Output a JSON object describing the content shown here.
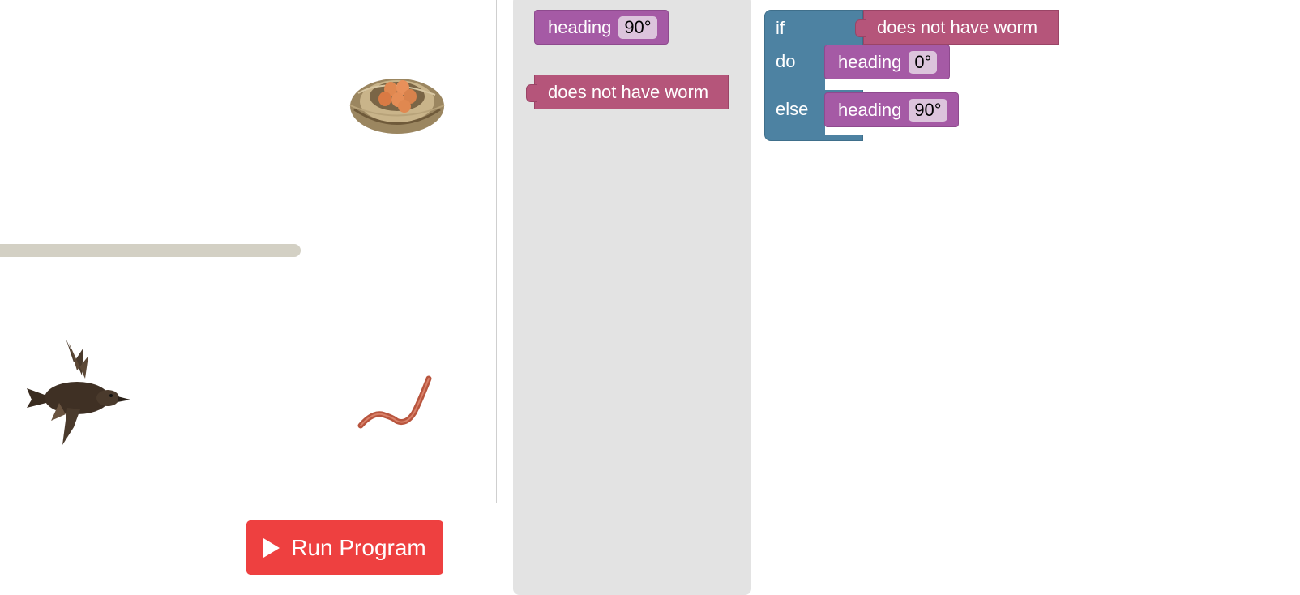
{
  "run_button": {
    "label": "Run Program",
    "icon": "play-icon"
  },
  "toolbox": {
    "heading_block": {
      "label": "heading",
      "value": "90°"
    },
    "worm_block": {
      "label": "does not have worm"
    }
  },
  "workspace": {
    "if_label": "if",
    "do_label": "do",
    "else_label": "else",
    "condition": {
      "label": "does not have worm"
    },
    "do_block": {
      "label": "heading",
      "value": "0°"
    },
    "else_block": {
      "label": "heading",
      "value": "90°"
    }
  },
  "colors": {
    "run_button": "#ee4040",
    "heading_block": "#a55aa5",
    "condition_block": "#b5557a",
    "if_block": "#4d82a2",
    "toolbox_bg": "#e3e3e3",
    "wall": "#d3d0c4"
  }
}
